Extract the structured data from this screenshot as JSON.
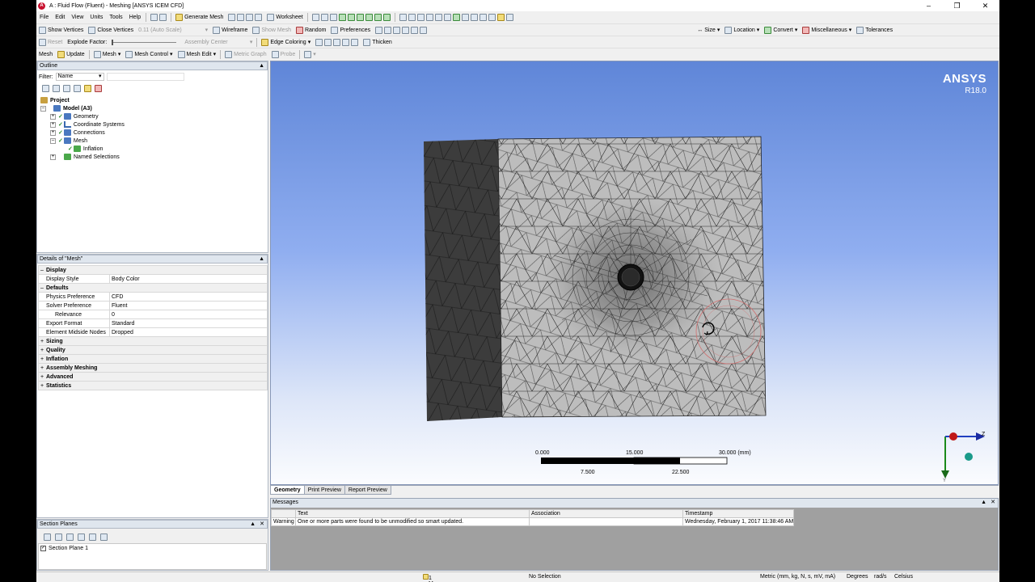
{
  "window": {
    "title": "A : Fluid Flow (Fluent) - Meshing [ANSYS ICEM CFD]"
  },
  "menu": [
    "File",
    "Edit",
    "View",
    "Units",
    "Tools",
    "Help"
  ],
  "toolbar1": {
    "generate_mesh": "Generate Mesh",
    "worksheet": "Worksheet"
  },
  "toolbar2": {
    "show_vertices": "Show Vertices",
    "close_vertices": "Close Vertices",
    "auto_scale": "0.11 (Auto Scale)",
    "wireframe": "Wireframe",
    "show_mesh": "Show Mesh",
    "random": "Random",
    "preferences": "Preferences",
    "size": "Size",
    "location": "Location",
    "convert": "Convert",
    "miscellaneous": "Miscellaneous",
    "tolerances": "Tolerances"
  },
  "toolbar3": {
    "reset": "Reset",
    "explode_factor": "Explode Factor:",
    "assembly_center": "Assembly Center",
    "edge_coloring": "Edge Coloring",
    "thicken": "Thicken"
  },
  "toolbar4": {
    "mesh": "Mesh",
    "update": "Update",
    "mesh_menu": "Mesh",
    "mesh_control": "Mesh Control",
    "mesh_edit": "Mesh Edit",
    "metric_graph": "Metric Graph",
    "probe": "Probe"
  },
  "outline": {
    "title": "Outline",
    "filter_label": "Filter:",
    "filter_value": "Name",
    "tree": {
      "project": "Project",
      "model": "Model (A3)",
      "geometry": "Geometry",
      "coordinate_systems": "Coordinate Systems",
      "connections": "Connections",
      "mesh": "Mesh",
      "inflation": "Inflation",
      "named_selections": "Named Selections"
    }
  },
  "details": {
    "title": "Details of \"Mesh\"",
    "display": "Display",
    "display_style_k": "Display Style",
    "display_style_v": "Body Color",
    "defaults": "Defaults",
    "physics_k": "Physics Preference",
    "physics_v": "CFD",
    "solver_k": "Solver Preference",
    "solver_v": "Fluent",
    "relevance_k": "Relevance",
    "relevance_v": "0",
    "export_k": "Export Format",
    "export_v": "Standard",
    "midside_k": "Element Midside Nodes",
    "midside_v": "Dropped",
    "sizing": "Sizing",
    "quality": "Quality",
    "inflation": "Inflation",
    "assembly_meshing": "Assembly Meshing",
    "advanced": "Advanced",
    "statistics": "Statistics"
  },
  "section_planes": {
    "title": "Section Planes",
    "item": "Section Plane 1"
  },
  "viewport": {
    "brand": "ANSYS",
    "version": "R18.0",
    "scale": {
      "s0": "0.000",
      "s1": "15.000",
      "s2": "30.000 (mm)",
      "s3": "7.500",
      "s4": "22.500"
    },
    "axis_z": "Z",
    "axis_y": "Y"
  },
  "view_tabs": [
    "Geometry",
    "Print Preview",
    "Report Preview"
  ],
  "messages": {
    "title": "Messages",
    "columns": [
      "",
      "Text",
      "Association",
      "Timestamp"
    ],
    "row": {
      "type": "Warning",
      "text": "One or more parts were found to be unmodified so smart updated.",
      "association": "",
      "timestamp": "Wednesday, February 1, 2017 11:38:46 AM"
    }
  },
  "status": {
    "messages": "1 Message",
    "selection": "No Selection",
    "units": "Metric (mm, kg, N, s, mV, mA)",
    "angle": "Degrees",
    "rate": "rad/s",
    "temp": "Celsius"
  }
}
